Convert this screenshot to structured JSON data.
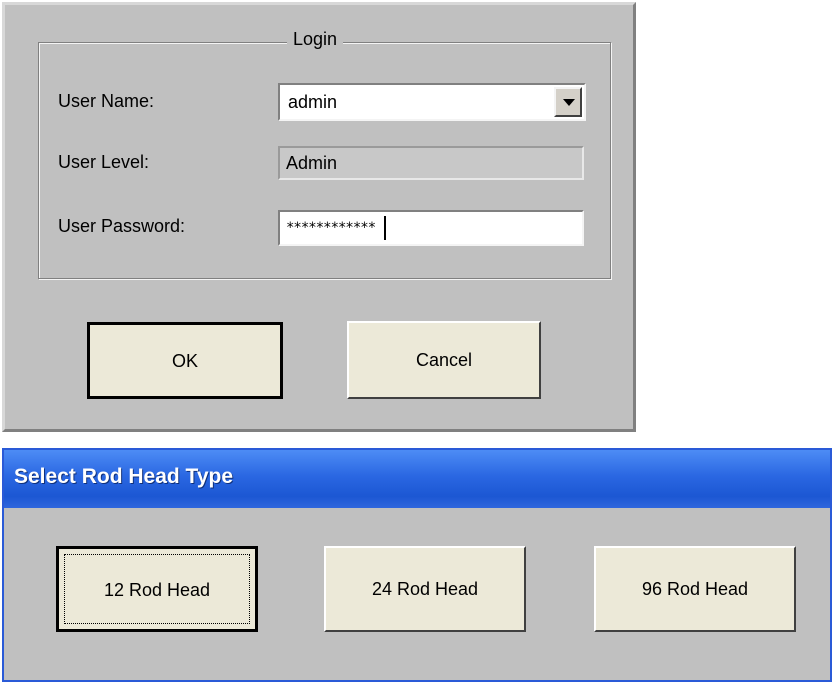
{
  "login": {
    "group_title": "Login",
    "user_name_label": "User Name:",
    "user_name_value": "admin",
    "user_level_label": "User Level:",
    "user_level_value": "Admin",
    "user_password_label": "User Password:",
    "user_password_value": "************",
    "ok_label": "OK",
    "cancel_label": "Cancel"
  },
  "rod_head": {
    "title": "Select Rod Head Type",
    "buttons": [
      {
        "label": "12 Rod Head"
      },
      {
        "label": "24 Rod Head"
      },
      {
        "label": "96 Rod Head"
      }
    ]
  },
  "colors": {
    "dialog_background": "#c0c0c0",
    "button_face": "#ece9d8",
    "titlebar_blue": "#2a67e2"
  },
  "icons": {
    "dropdown": "chevron-down-icon"
  }
}
